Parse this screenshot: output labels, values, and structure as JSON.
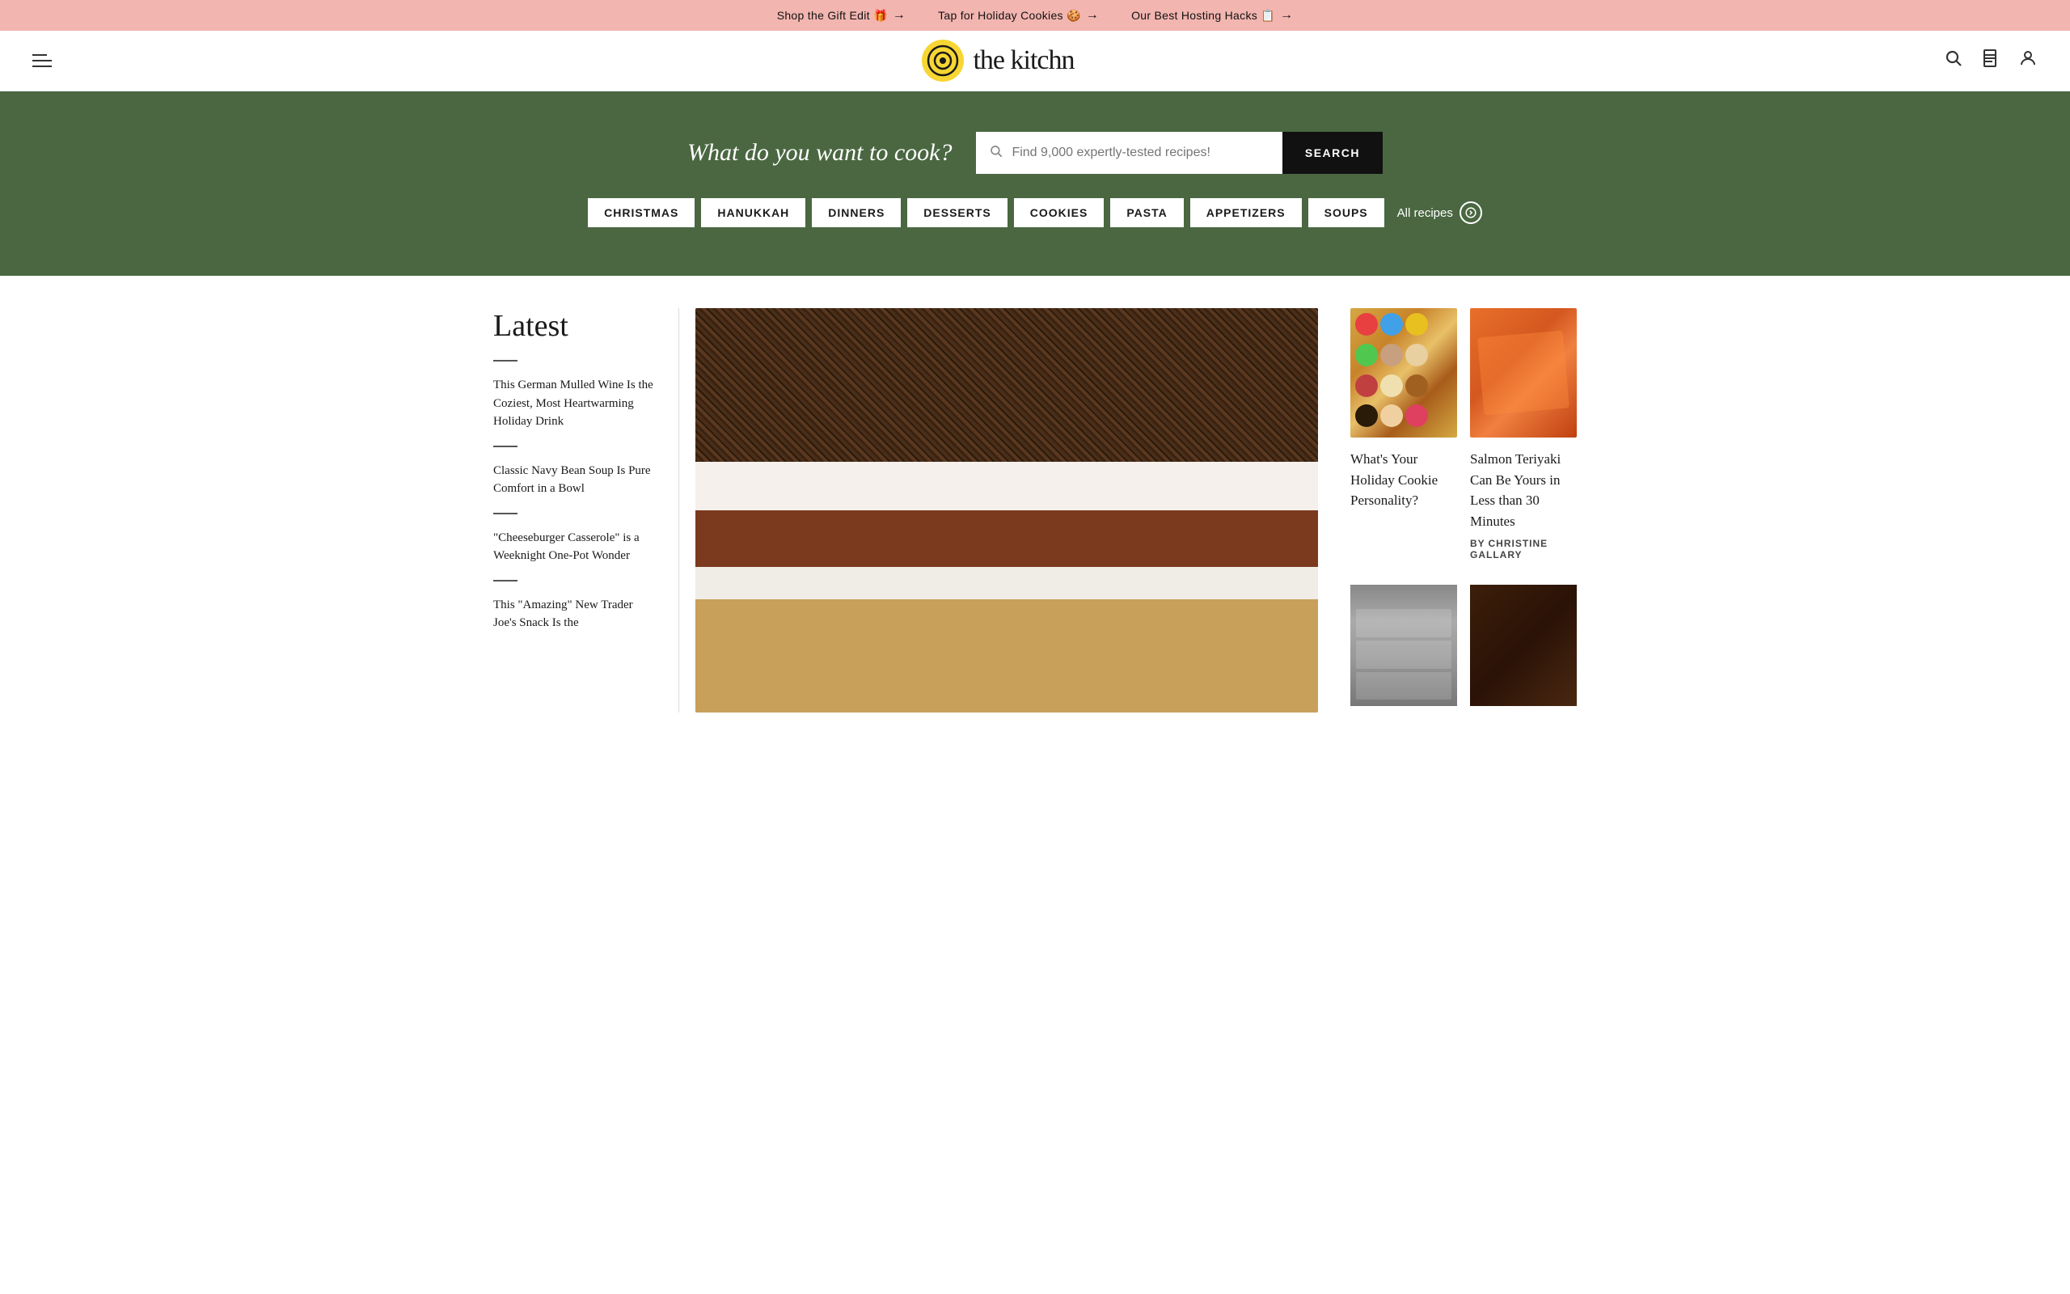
{
  "banner": {
    "items": [
      {
        "text": "Shop the Gift Edit 🎁",
        "arrow": "→",
        "label": "shop-gift-edit"
      },
      {
        "text": "Tap for Holiday Cookies 🍪",
        "arrow": "→",
        "label": "holiday-cookies"
      },
      {
        "text": "Our Best Hosting Hacks 📋",
        "arrow": "→",
        "label": "hosting-hacks"
      }
    ]
  },
  "header": {
    "logo_text": "the kitchn",
    "search_aria": "Search",
    "bookmark_aria": "Saved",
    "account_aria": "Account"
  },
  "hero": {
    "title": "What do you want to cook?",
    "search_placeholder": "Find 9,000 expertly-tested recipes!",
    "search_button": "SEARCH",
    "categories": [
      "CHRISTMAS",
      "HANUKKAH",
      "DINNERS",
      "DESSERTS",
      "COOKIES",
      "PASTA",
      "APPETIZERS",
      "SOUPS"
    ],
    "all_recipes_label": "All recipes"
  },
  "latest": {
    "section_title": "Latest",
    "items": [
      {
        "title": "This German Mulled Wine Is the Coziest, Most Heartwarming Holiday Drink"
      },
      {
        "title": "Classic Navy Bean Soup Is Pure Comfort in a Bowl"
      },
      {
        "title": "\"Cheeseburger Casserole\" is a Weeknight One-Pot Wonder"
      },
      {
        "title": "This \"Amazing\" New Trader Joe's Snack Is the"
      }
    ]
  },
  "feature": {
    "alt": "Layered chocolate dessert bar"
  },
  "right_column": {
    "top_cards": [
      {
        "type": "cookies",
        "title": "What's Your Holiday Cookie Personality?",
        "byline": null,
        "byline_author": null
      },
      {
        "type": "salmon",
        "title": "Salmon Teriyaki Can Be Yours in Less than 30 Minutes",
        "byline_prefix": "By",
        "byline_author": "CHRISTINE GALLARY"
      }
    ],
    "bottom_cards": [
      {
        "type": "fridge",
        "title": ""
      },
      {
        "type": "brownie",
        "title": ""
      }
    ]
  }
}
